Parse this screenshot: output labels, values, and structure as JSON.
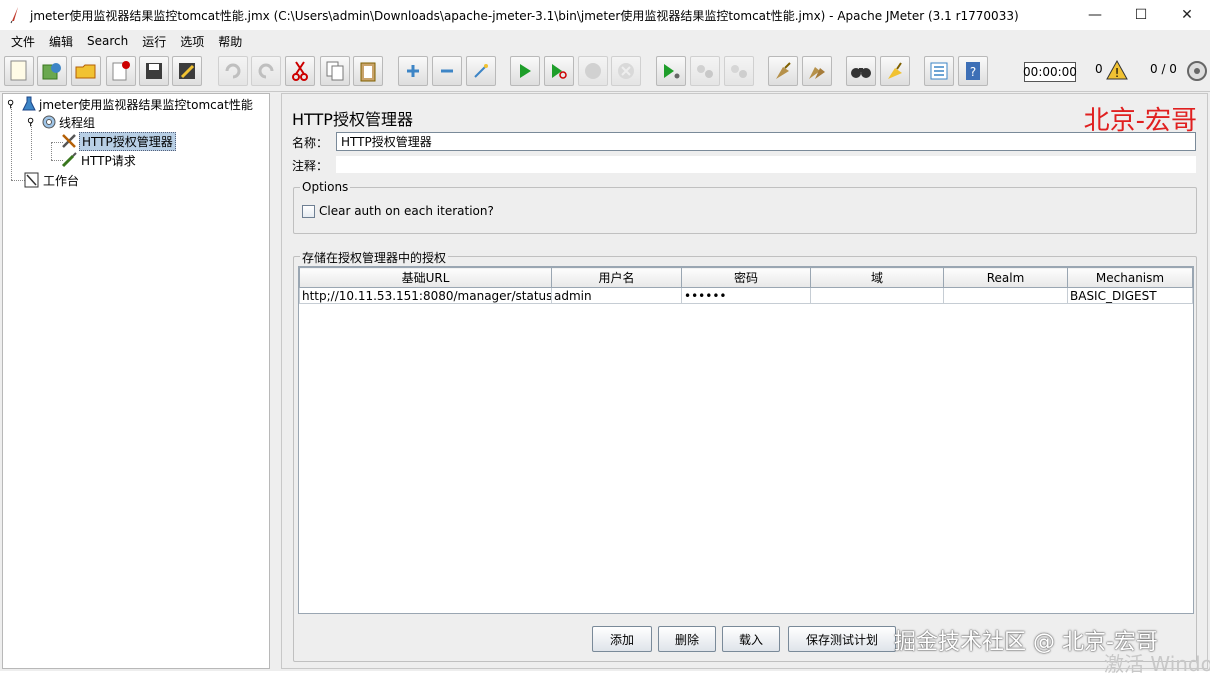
{
  "window": {
    "title": "jmeter使用监视器结果监控tomcat性能.jmx (C:\\Users\\admin\\Downloads\\apache-jmeter-3.1\\bin\\jmeter使用监视器结果监控tomcat性能.jmx) - Apache JMeter (3.1 r1770033)",
    "minimize": "—",
    "maximize": "☐",
    "close": "✕"
  },
  "menu": [
    "文件",
    "编辑",
    "Search",
    "运行",
    "选项",
    "帮助"
  ],
  "toolbar": {
    "timer": "00:00:00",
    "error_count": "0",
    "thread_count": "0 / 0"
  },
  "tree": {
    "root": "jmeter使用监视器结果监控tomcat性能",
    "thread_group": "线程组",
    "auth_manager": "HTTP授权管理器",
    "http_request": "HTTP请求",
    "workbench": "工作台"
  },
  "panel": {
    "title": "HTTP授权管理器",
    "watermark_top": "北京-宏哥",
    "name_label": "名称：",
    "name_value": "HTTP授权管理器",
    "comment_label": "注释：",
    "comment_value": "",
    "options_title": "Options",
    "clear_auth_label": "Clear auth on each iteration?",
    "clear_auth_checked": false,
    "auth_title": "存储在授权管理器中的授权"
  },
  "table": {
    "headers": [
      "基础URL",
      "用户名",
      "密码",
      "域",
      "Realm",
      "Mechanism"
    ],
    "rows": [
      [
        "http;//10.11.53.151:8080/manager/status",
        "admin",
        "••••••",
        "",
        "",
        "BASIC_DIGEST"
      ]
    ]
  },
  "buttons": {
    "add": "添加",
    "delete": "删除",
    "load": "载入",
    "save": "保存测试计划"
  },
  "watermark_bottom": "掘金技术社区 @ 北京-宏哥",
  "watermark_windows": "激活 Windo"
}
